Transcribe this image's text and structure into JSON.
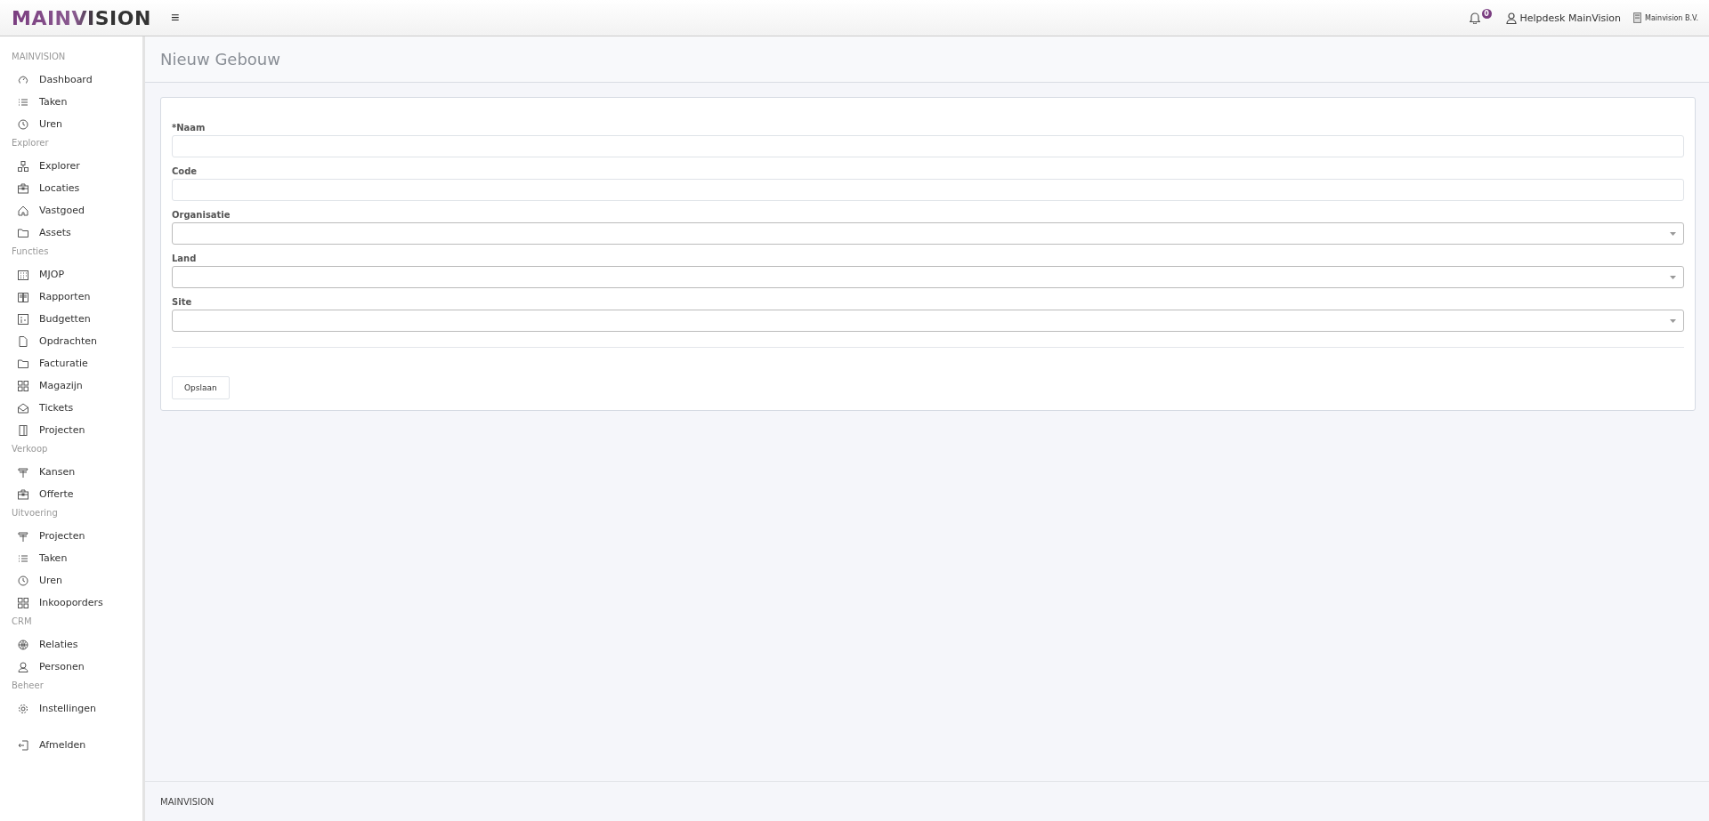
{
  "header": {
    "logo": "MAINVISION",
    "menu_glyph": "≡",
    "notifications": "0",
    "user": "Helpdesk MainVision",
    "company": "Mainvision B.V."
  },
  "sidebar": {
    "sections": [
      {
        "title": "MAINVISION",
        "items": [
          "Dashboard",
          "Taken",
          "Uren"
        ]
      },
      {
        "title": "Explorer",
        "items": [
          "Explorer",
          "Locaties",
          "Vastgoed",
          "Assets"
        ]
      },
      {
        "title": "Functies",
        "items": [
          "MJOP",
          "Rapporten",
          "Budgetten",
          "Opdrachten",
          "Facturatie",
          "Magazijn",
          "Tickets",
          "Projecten"
        ]
      },
      {
        "title": "Verkoop",
        "items": [
          "Kansen",
          "Offerte"
        ]
      },
      {
        "title": "Uitvoering",
        "items": [
          "Projecten",
          "Taken",
          "Uren",
          "Inkooporders"
        ]
      },
      {
        "title": "CRM",
        "items": [
          "Relaties",
          "Personen"
        ]
      },
      {
        "title": "Beheer",
        "items": [
          "Instellingen"
        ]
      }
    ],
    "logout": "Afmelden"
  },
  "page": {
    "title": "Nieuw Gebouw"
  },
  "form": {
    "fields": [
      {
        "label": "Naam",
        "required": true,
        "kind": "text"
      },
      {
        "label": "Code",
        "required": false,
        "kind": "text"
      },
      {
        "label": "Organisatie",
        "required": false,
        "kind": "select"
      },
      {
        "label": "Land",
        "required": false,
        "kind": "select"
      },
      {
        "label": "Site",
        "required": false,
        "kind": "select"
      }
    ],
    "required_mark": "*",
    "save_button": "Opslaan"
  },
  "footer": "MAINVISION"
}
